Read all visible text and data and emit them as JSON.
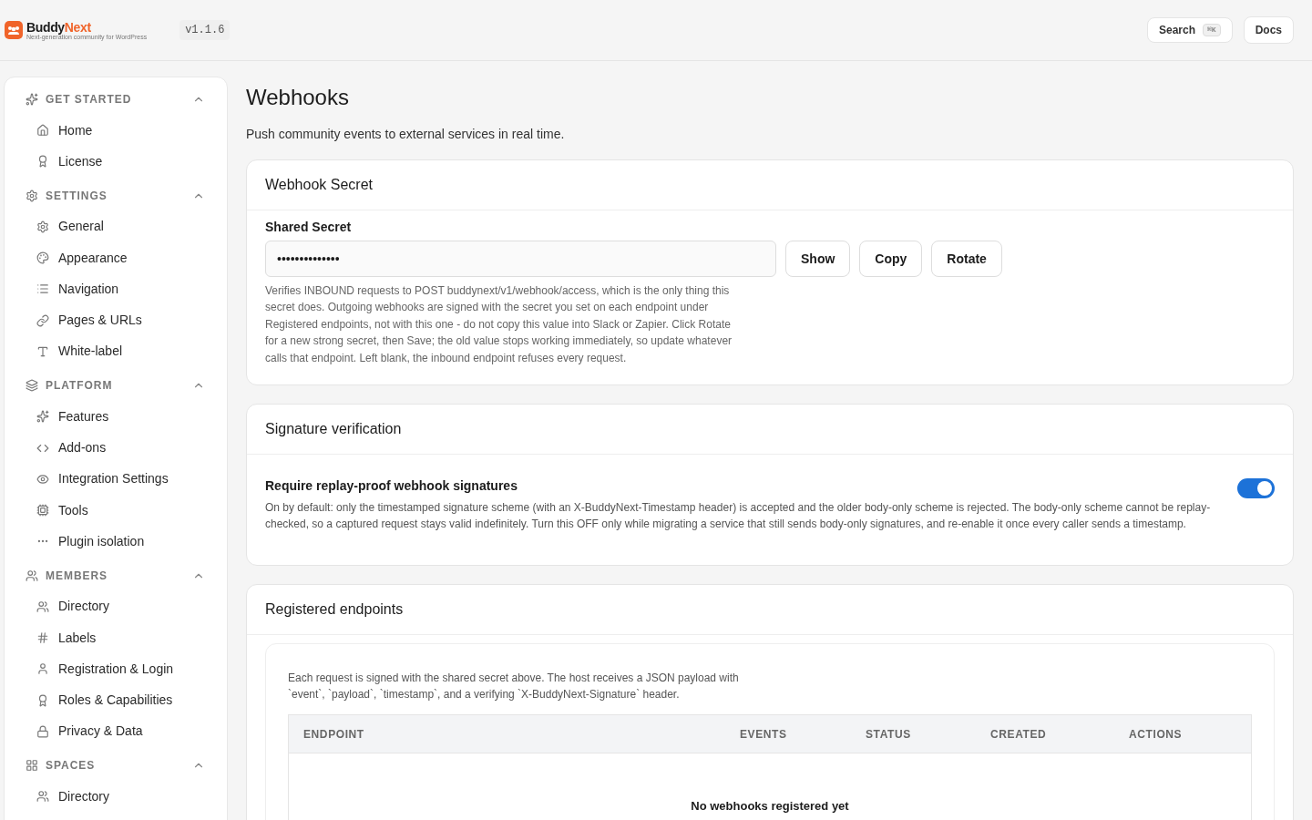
{
  "header": {
    "brand": {
      "name_first": "Buddy",
      "name_second": "Next",
      "tagline": "Next-generation community for WordPress"
    },
    "version": "v1.1.6",
    "search": {
      "label": "Search",
      "shortcut": "⌘K"
    },
    "docs": "Docs"
  },
  "sidebar": [
    {
      "label": "GET STARTED",
      "expanded": true,
      "items": [
        {
          "label": "Home"
        },
        {
          "label": "License"
        }
      ]
    },
    {
      "label": "SETTINGS",
      "expanded": true,
      "items": [
        {
          "label": "General"
        },
        {
          "label": "Appearance"
        },
        {
          "label": "Navigation"
        },
        {
          "label": "Pages & URLs"
        },
        {
          "label": "White-label"
        }
      ]
    },
    {
      "label": "PLATFORM",
      "expanded": true,
      "items": [
        {
          "label": "Features"
        },
        {
          "label": "Add-ons"
        },
        {
          "label": "Integration Settings"
        },
        {
          "label": "Tools"
        },
        {
          "label": "Plugin isolation"
        }
      ]
    },
    {
      "label": "MEMBERS",
      "expanded": true,
      "items": [
        {
          "label": "Directory"
        },
        {
          "label": "Labels"
        },
        {
          "label": "Registration & Login"
        },
        {
          "label": "Roles & Capabilities"
        },
        {
          "label": "Privacy & Data"
        }
      ]
    },
    {
      "label": "SPACES",
      "expanded": true,
      "items": [
        {
          "label": "Directory"
        }
      ]
    }
  ],
  "page": {
    "title": "Webhooks",
    "subtitle": "Push community events to external services in real time."
  },
  "secret_card": {
    "title": "Webhook Secret",
    "field_label": "Shared Secret",
    "value": "••••••••••••••",
    "buttons": [
      "Show",
      "Copy",
      "Rotate"
    ],
    "help": "Verifies INBOUND requests to POST buddynext/v1/webhook/access, which is the only thing this secret does. Outgoing webhooks are signed with the secret you set on each endpoint under Registered endpoints, not with this one - do not copy this value into Slack or Zapier. Click Rotate for a new strong secret, then Save; the old value stops working immediately, so update whatever calls that endpoint. Left blank, the inbound endpoint refuses every request."
  },
  "signature_card": {
    "title": "Signature verification",
    "setting": {
      "label": "Require replay-proof webhook signatures",
      "on": true,
      "description": "On by default: only the timestamped signature scheme (with an X-BuddyNext-Timestamp header) is accepted and the older body-only scheme is rejected. The body-only scheme cannot be replay-checked, so a captured request stays valid indefinitely. Turn this OFF only while migrating a service that still sends body-only signatures, and re-enable it once every caller sends a timestamp."
    }
  },
  "endpoints_card": {
    "title": "Registered endpoints",
    "intro": "Each request is signed with the shared secret above. The host receives a JSON payload with `event`, `payload`, `timestamp`, and a verifying `X-BuddyNext-Signature` header.",
    "table": {
      "columns": [
        "ENDPOINT",
        "EVENTS",
        "STATUS",
        "CREATED",
        "ACTIONS"
      ],
      "empty": "No webhooks registered yet"
    }
  }
}
